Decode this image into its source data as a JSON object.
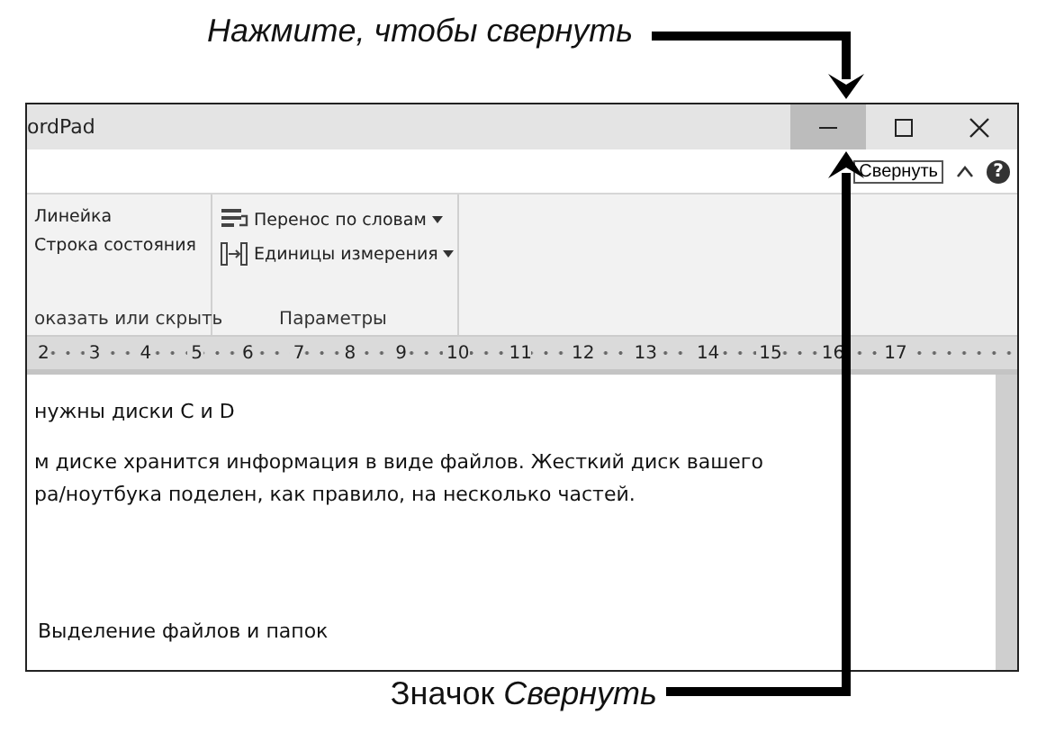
{
  "callouts": [
    {
      "kind": "top",
      "text": "Нажмите, чтобы свернуть"
    },
    {
      "kind": "bottom",
      "text": "Значок *Свернуть*"
    }
  ],
  "window": {
    "title": "ordPad",
    "controls": [
      {
        "kind": "minimize",
        "highlighted": true
      },
      {
        "kind": "maximize",
        "highlighted": false
      },
      {
        "kind": "close",
        "highlighted": false
      }
    ],
    "tooltip": "Свернуть",
    "help": "?"
  },
  "ribbon": {
    "groups": [
      {
        "label": "оказать или скрыть",
        "items": [
          {
            "kind": "plain",
            "text": "Линейка"
          },
          {
            "kind": "plain",
            "text": "Строка состояния"
          }
        ]
      },
      {
        "label": "Параметры",
        "items": [
          {
            "kind": "wrap",
            "text": "Перенос по словам",
            "dropdown": true
          },
          {
            "kind": "units",
            "text": "Единицы измерения",
            "dropdown": true
          }
        ]
      }
    ]
  },
  "ruler": [
    "2",
    "3",
    "4",
    "5",
    "6",
    "7",
    "8",
    "9",
    "10",
    "11",
    "12",
    "13",
    "14",
    "15",
    "16",
    "17"
  ],
  "document": [
    {
      "kind": "heading",
      "text": "нужны диски C и D"
    },
    {
      "kind": "paragraph",
      "text": "м диске хранится информация в виде файлов. Жесткий диск вашего"
    },
    {
      "kind": "paragraph",
      "text": "ра/ноутбука поделен, как правило, на несколько частей."
    },
    {
      "kind": "spacer-heading",
      "text": "Выделение файлов и папок"
    }
  ]
}
